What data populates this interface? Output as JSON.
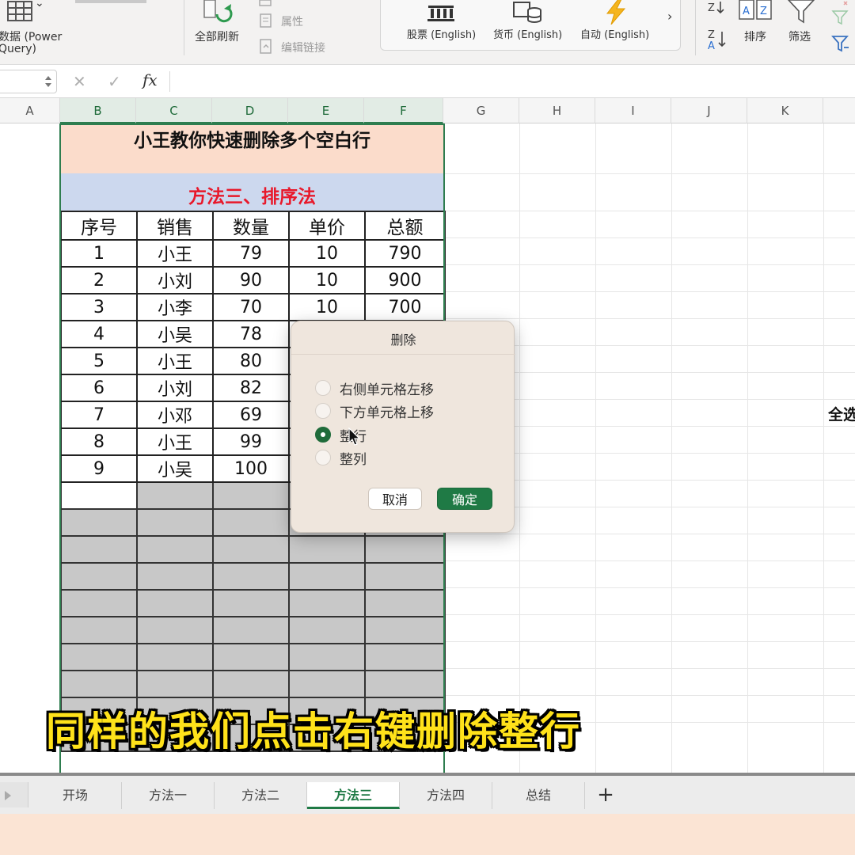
{
  "ribbon": {
    "get_data_line1": "数据 (Power",
    "get_data_line2": "Query)",
    "refresh_all": "全部刷新",
    "properties": "属性",
    "edit_links": "编辑链接",
    "datatypes": [
      {
        "label": "股票 (English)",
        "icon": "bank-icon"
      },
      {
        "label": "货币 (English)",
        "icon": "currency-icon"
      },
      {
        "label": "自动 (English)",
        "icon": "lightning-icon"
      }
    ],
    "sort": "排序",
    "filter": "筛选"
  },
  "columns": [
    "A",
    "B",
    "C",
    "D",
    "E",
    "F",
    "G",
    "H",
    "I",
    "J",
    "K"
  ],
  "table": {
    "title": "小王教你快速删除多个空白行",
    "subtitle": "方法三、排序法",
    "headers": [
      "序号",
      "销售",
      "数量",
      "单价",
      "总额"
    ],
    "rows": [
      [
        "1",
        "小王",
        "79",
        "10",
        "790"
      ],
      [
        "2",
        "小刘",
        "90",
        "10",
        "900"
      ],
      [
        "3",
        "小李",
        "70",
        "10",
        "700"
      ],
      [
        "4",
        "小吴",
        "78",
        "",
        ""
      ],
      [
        "5",
        "小王",
        "80",
        "",
        ""
      ],
      [
        "6",
        "小刘",
        "82",
        "",
        ""
      ],
      [
        "7",
        "小邓",
        "69",
        "",
        ""
      ],
      [
        "8",
        "小王",
        "99",
        "",
        ""
      ],
      [
        "9",
        "小吴",
        "100",
        "",
        ""
      ]
    ]
  },
  "side_text": "全选",
  "dialog": {
    "title": "删除",
    "options": [
      "右侧单元格左移",
      "下方单元格上移",
      "整行",
      "整列"
    ],
    "selected_index": 2,
    "cancel": "取消",
    "ok": "确定"
  },
  "caption": "同样的我们点击右键删除整行",
  "sheet_tabs": [
    "开场",
    "方法一",
    "方法二",
    "方法三",
    "方法四",
    "总结"
  ],
  "active_tab": "方法三",
  "colors": {
    "accent_green": "#1f7a45",
    "title_fill": "#fbdccb",
    "subtitle_fill": "#ccd8ee",
    "subtitle_text": "#e8182a",
    "blank_rows_fill": "#c8c8c8",
    "caption_yellow": "#ffe21a"
  }
}
